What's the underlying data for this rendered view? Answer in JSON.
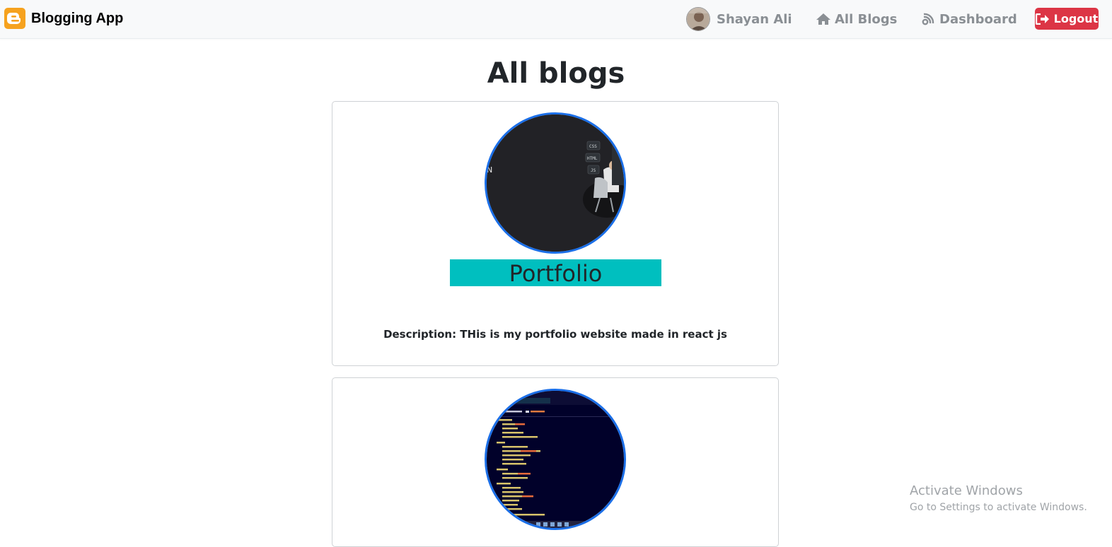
{
  "navbar": {
    "brand": {
      "icon": "blogger-logo-icon",
      "title": "Blogging App",
      "accent": "#f6a21e"
    },
    "user": {
      "name": "Shayan Ali",
      "avatar": "avatar"
    },
    "links": [
      {
        "label": "All Blogs",
        "icon": "home-icon"
      },
      {
        "label": "Dashboard",
        "icon": "blog-feed-icon"
      }
    ],
    "logout": {
      "label": "Logout",
      "icon": "sign-out-icon",
      "color": "#dc3545"
    }
  },
  "main": {
    "title": "All blogs",
    "blogs": [
      {
        "title": "Portfolio",
        "description": "Description: THis is my portfolio website made in react js",
        "image": "developer-illustration-thumbnail",
        "title_bg": "#00bfbf"
      },
      {
        "title": "",
        "description": "",
        "image": "code-editor-screenshot-thumbnail"
      }
    ],
    "image_border_color": "#1b6fe8"
  },
  "watermark": {
    "title": "Activate Windows",
    "subtitle": "Go to Settings to activate Windows."
  }
}
